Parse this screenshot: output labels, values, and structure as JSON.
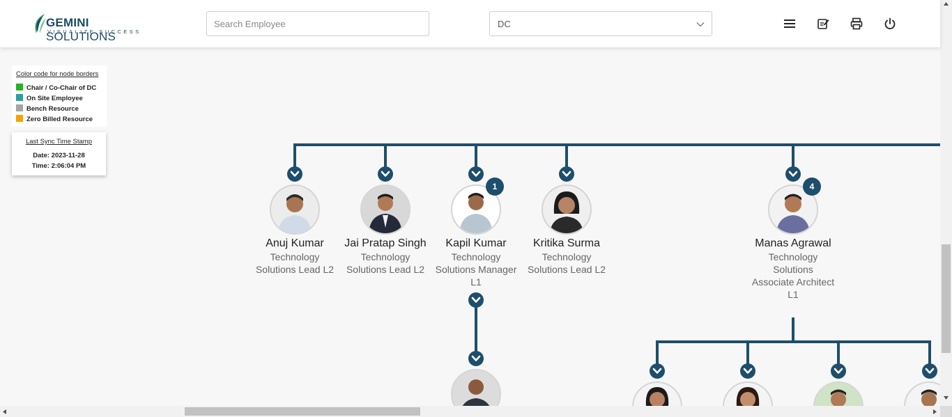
{
  "header": {
    "brand_name_bold": "GEMINI",
    "brand_name_rest": " SOLUTIONS",
    "brand_tagline": "VISUALIZE SUCCESS",
    "search_placeholder": "Search Employee",
    "dept_select_value": "DC",
    "icons": [
      "menu-icon",
      "notes-icon",
      "print-icon",
      "power-icon"
    ]
  },
  "legend": {
    "title": "Color code for node borders",
    "items": [
      {
        "label": "Chair / Co-Chair of DC",
        "color": "#22b522"
      },
      {
        "label": "On Site Employee",
        "color": "#2aa0a0"
      },
      {
        "label": "Bench Resource",
        "color": "#a4a4a4"
      },
      {
        "label": "Zero Billed Resource",
        "color": "#f5a300"
      }
    ]
  },
  "sync": {
    "title": "Last Sync Time Stamp",
    "date": "Date: 2023-11-28",
    "time": "Time: 2:06:04 PM"
  },
  "nodes": [
    {
      "name": "Anuj Kumar",
      "title_lines": [
        "Technology",
        "Solutions Lead L2"
      ],
      "badge": ""
    },
    {
      "name": "Jai Pratap Singh",
      "title_lines": [
        "Technology",
        "Solutions Lead L2"
      ],
      "badge": ""
    },
    {
      "name": "Kapil Kumar",
      "title_lines": [
        "Technology",
        "Solutions Manager",
        "L1"
      ],
      "badge": "1"
    },
    {
      "name": "Kritika Surma",
      "title_lines": [
        "Technology",
        "Solutions Lead L2"
      ],
      "badge": ""
    },
    {
      "name": "Manas Agrawal",
      "title_lines": [
        "Technology",
        "Solutions",
        "Associate Architect",
        "L1"
      ],
      "badge": "4"
    }
  ],
  "colors": {
    "tree_line": "#1e4e6c",
    "brand": "#1c4a63"
  }
}
